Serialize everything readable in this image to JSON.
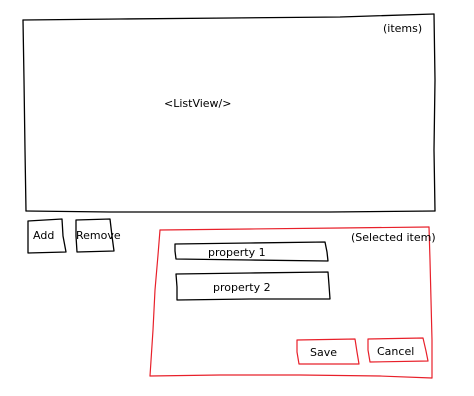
{
  "listview": {
    "corner_label": "(items)",
    "center_label": "<ListView/>"
  },
  "buttons": {
    "add_label": "Add",
    "remove_label": "Remove"
  },
  "detail_panel": {
    "title": "(Selected item)",
    "property1_label": "property 1",
    "property2_label": "property 2",
    "save_label": "Save",
    "cancel_label": "Cancel"
  },
  "colors": {
    "ink": "#000000",
    "panel_border": "#e8202a",
    "background": "#ffffff"
  }
}
